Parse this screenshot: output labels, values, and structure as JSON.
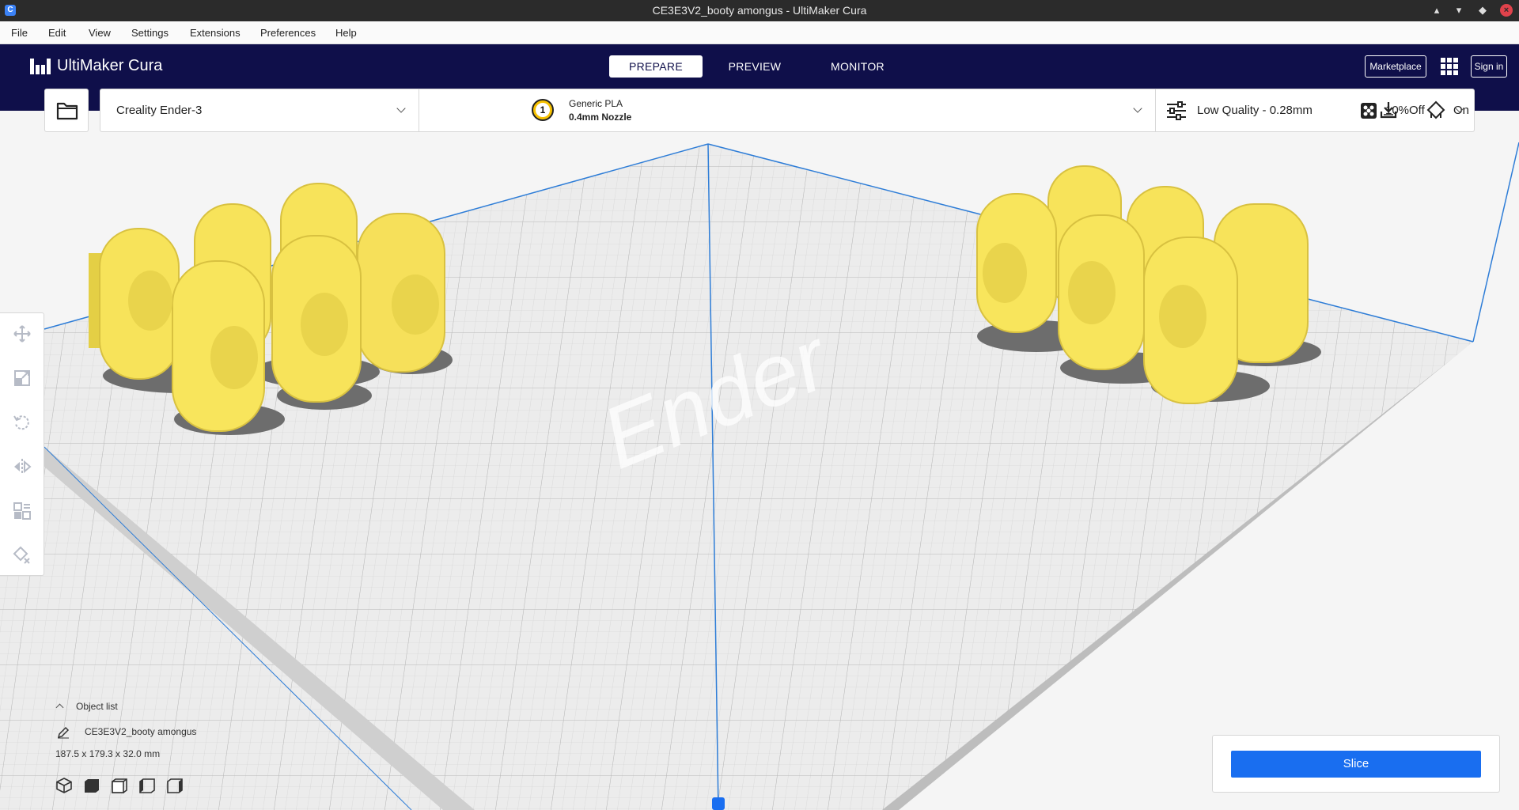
{
  "window": {
    "title": "CE3E3V2_booty amongus - UltiMaker Cura",
    "minimize_label": "▴",
    "restore_label": "▾",
    "maximize_label": "◆",
    "close_label": "×"
  },
  "menu": [
    "File",
    "Edit",
    "View",
    "Settings",
    "Extensions",
    "Preferences",
    "Help"
  ],
  "header": {
    "brand": "UltiMaker Cura",
    "stages": [
      {
        "label": "PREPARE",
        "active": true
      },
      {
        "label": "PREVIEW",
        "active": false
      },
      {
        "label": "MONITOR",
        "active": false
      }
    ],
    "marketplace_label": "Marketplace",
    "signin_label": "Sign in"
  },
  "config": {
    "printer": "Creality Ender-3",
    "extruder_number": "1",
    "material": "Generic PLA",
    "nozzle": "0.4mm Nozzle",
    "quality": "Low Quality - 0.28mm",
    "infill": "10%",
    "support": "On",
    "adhesion": "Off"
  },
  "plate_logo_text": "Ender",
  "object_list": {
    "toggle_label": "Object list",
    "object_name": "CE3E3V2_booty amongus",
    "dimensions": "187.5 x 179.3 x 32.0 mm"
  },
  "slice_label": "Slice",
  "colors": {
    "header_bg": "#0f0f4a",
    "accent_blue": "#196ef0",
    "model_yellow": "#f7e35a",
    "plate_grey": "#e6e6e6"
  },
  "tools": [
    "move-icon",
    "scale-icon",
    "rotate-icon",
    "mirror-icon",
    "per-model-settings-icon",
    "support-blocker-icon"
  ]
}
